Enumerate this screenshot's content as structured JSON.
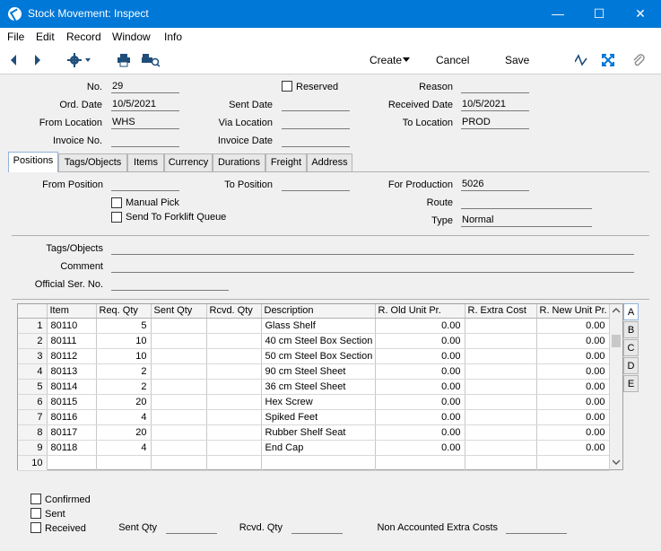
{
  "window": {
    "title": "Stock Movement: Inspect",
    "minimize": "—",
    "maximize": "☐",
    "close": "✕"
  },
  "menu": [
    "File",
    "Edit",
    "Record",
    "Window",
    "Info"
  ],
  "toolbar": {
    "create": "Create",
    "cancel": "Cancel",
    "save": "Save"
  },
  "header": {
    "no_label": "No.",
    "no_value": "29",
    "reserved_label": "Reserved",
    "reserved_checked": false,
    "reason_label": "Reason",
    "reason_value": "",
    "ord_date_label": "Ord. Date",
    "ord_date_value": "10/5/2021",
    "sent_date_label": "Sent Date",
    "sent_date_value": "",
    "received_date_label": "Received Date",
    "received_date_value": "10/5/2021",
    "from_location_label": "From Location",
    "from_location_value": "WHS",
    "via_location_label": "Via Location",
    "via_location_value": "",
    "to_location_label": "To Location",
    "to_location_value": "PROD",
    "invoice_no_label": "Invoice No.",
    "invoice_no_value": "",
    "invoice_date_label": "Invoice Date",
    "invoice_date_value": ""
  },
  "tabs": [
    "Positions",
    "Tags/Objects",
    "Items",
    "Currency",
    "Durations",
    "Freight",
    "Address"
  ],
  "positions": {
    "from_position_label": "From Position",
    "from_position_value": "",
    "to_position_label": "To Position",
    "to_position_value": "",
    "for_production_label": "For Production",
    "for_production_value": "5026",
    "manual_pick_label": "Manual Pick",
    "forklift_label": "Send To Forklift Queue",
    "route_label": "Route",
    "route_value": "",
    "type_label": "Type",
    "type_value": "Normal",
    "tags_label": "Tags/Objects",
    "tags_value": "",
    "comment_label": "Comment",
    "comment_value": "",
    "official_ser_label": "Official Ser. No.",
    "official_ser_value": ""
  },
  "matrix": {
    "columns": [
      "",
      "Item",
      "Req. Qty",
      "Sent Qty",
      "Rcvd. Qty",
      "Description",
      "R. Old Unit Pr.",
      "R. Extra Cost",
      "R. New Unit Pr."
    ],
    "rows": [
      [
        "1",
        "80110",
        "5",
        "",
        "",
        "Glass Shelf",
        "0.00",
        "",
        "0.00"
      ],
      [
        "2",
        "80111",
        "10",
        "",
        "",
        "40 cm Steel Box Section",
        "0.00",
        "",
        "0.00"
      ],
      [
        "3",
        "80112",
        "10",
        "",
        "",
        "50 cm Steel Box Section",
        "0.00",
        "",
        "0.00"
      ],
      [
        "4",
        "80113",
        "2",
        "",
        "",
        "90 cm Steel Sheet",
        "0.00",
        "",
        "0.00"
      ],
      [
        "5",
        "80114",
        "2",
        "",
        "",
        "36 cm Steel Sheet",
        "0.00",
        "",
        "0.00"
      ],
      [
        "6",
        "80115",
        "20",
        "",
        "",
        "Hex Screw",
        "0.00",
        "",
        "0.00"
      ],
      [
        "7",
        "80116",
        "4",
        "",
        "",
        "Spiked Feet",
        "0.00",
        "",
        "0.00"
      ],
      [
        "8",
        "80117",
        "20",
        "",
        "",
        "Rubber Shelf Seat",
        "0.00",
        "",
        "0.00"
      ],
      [
        "9",
        "80118",
        "4",
        "",
        "",
        "End Cap",
        "0.00",
        "",
        "0.00"
      ],
      [
        "10",
        "",
        "",
        "",
        "",
        "",
        "",
        "",
        ""
      ]
    ],
    "side_tabs": [
      "A",
      "B",
      "C",
      "D",
      "E"
    ]
  },
  "footer": {
    "confirmed_label": "Confirmed",
    "sent_label": "Sent",
    "received_label": "Received",
    "sent_qty_label": "Sent Qty",
    "sent_qty_value": "",
    "rcvd_qty_label": "Rcvd. Qty",
    "rcvd_qty_value": "",
    "non_accounted_label": "Non Accounted Extra Costs",
    "non_accounted_value": ""
  }
}
